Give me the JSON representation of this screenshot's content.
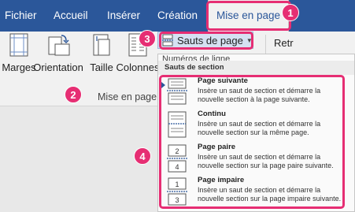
{
  "tabs": [
    "Fichier",
    "Accueil",
    "Insérer",
    "Création",
    "Mise en page"
  ],
  "ribbon": {
    "buttons": [
      "Marges",
      "Orientation",
      "Taille",
      "Colonnes"
    ],
    "group_label": "Mise en page",
    "sauts_de_page": "Sauts de page",
    "retr_label": "Retr",
    "partial_item": "Numéros de ligne"
  },
  "dropdown": {
    "header": "Sauts de section",
    "items": [
      {
        "title": "Page suivante",
        "desc": "Insère un saut de section et démarre la nouvelle section à la page suivante.",
        "icon": "section-break-next-page-icon"
      },
      {
        "title": "Continu",
        "desc": "Insère un saut de section et démarre la nouvelle section sur la même page.",
        "icon": "section-break-continuous-icon"
      },
      {
        "title": "Page paire",
        "desc": "Insère un saut de section et démarre la nouvelle section sur la page paire suivante.",
        "icon": "section-break-even-page-icon",
        "icon_numbers": [
          "2",
          "4"
        ]
      },
      {
        "title": "Page impaire",
        "desc": "Insère un saut de section et démarre la nouvelle section sur la page impaire suivante.",
        "icon": "section-break-odd-page-icon",
        "icon_numbers": [
          "1",
          "3"
        ]
      }
    ]
  },
  "badges": [
    "1",
    "2",
    "3",
    "4"
  ],
  "colors": {
    "tab_bar": "#2b579a",
    "highlight": "#e62e73"
  }
}
